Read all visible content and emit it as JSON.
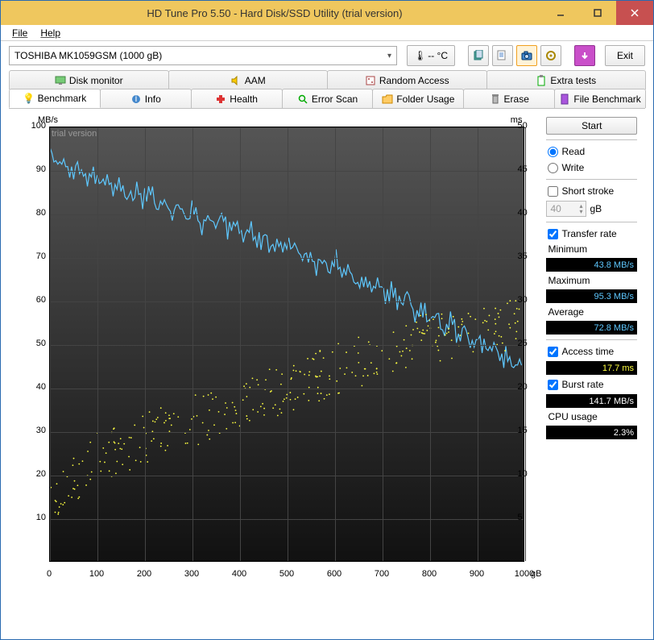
{
  "window": {
    "title": "HD Tune Pro 5.50 - Hard Disk/SSD Utility (trial version)"
  },
  "menu": {
    "file": "File",
    "help": "Help"
  },
  "toolbar": {
    "drive_selected": "TOSHIBA MK1059GSM (1000 gB)",
    "temp": "-- °C",
    "exit_label": "Exit"
  },
  "tabs_top": {
    "disk_monitor": "Disk monitor",
    "aam": "AAM",
    "random_access": "Random Access",
    "extra_tests": "Extra tests"
  },
  "tabs_bottom": {
    "benchmark": "Benchmark",
    "info": "Info",
    "health": "Health",
    "error_scan": "Error Scan",
    "folder_usage": "Folder Usage",
    "erase": "Erase",
    "file_benchmark": "File Benchmark"
  },
  "side": {
    "start": "Start",
    "read": "Read",
    "write": "Write",
    "short_stroke": "Short stroke",
    "short_stroke_val": "40",
    "short_stroke_unit": "gB",
    "transfer_rate": "Transfer rate",
    "minimum": "Minimum",
    "minimum_val": "43.8 MB/s",
    "maximum": "Maximum",
    "maximum_val": "95.3 MB/s",
    "average": "Average",
    "average_val": "72.8 MB/s",
    "access_time": "Access time",
    "access_time_val": "17.7 ms",
    "burst_rate": "Burst rate",
    "burst_rate_val": "141.7 MB/s",
    "cpu_usage": "CPU usage",
    "cpu_usage_val": "2.3%"
  },
  "chart": {
    "y_left_label": "MB/s",
    "y_right_label": "ms",
    "x_unit": "gB",
    "watermark": "trial version"
  },
  "chart_data": {
    "type": "line_and_scatter",
    "x_range": [
      0,
      1000
    ],
    "x_ticks": [
      0,
      100,
      200,
      300,
      400,
      500,
      600,
      700,
      800,
      900,
      1000
    ],
    "y_left_range": [
      0,
      100
    ],
    "y_left_ticks": [
      10,
      20,
      30,
      40,
      50,
      60,
      70,
      80,
      90,
      100
    ],
    "y_right_range": [
      0,
      50
    ],
    "y_right_ticks": [
      5,
      10,
      15,
      20,
      25,
      30,
      35,
      40,
      45,
      50
    ],
    "series": [
      {
        "name": "Transfer rate (MB/s)",
        "axis": "left",
        "type": "line",
        "color": "#5ec8ff",
        "x": [
          0,
          25,
          50,
          75,
          100,
          125,
          150,
          175,
          200,
          225,
          250,
          275,
          300,
          325,
          350,
          375,
          400,
          425,
          450,
          475,
          500,
          525,
          550,
          575,
          600,
          625,
          650,
          675,
          700,
          725,
          750,
          775,
          800,
          825,
          850,
          875,
          900,
          925,
          950,
          975,
          1000
        ],
        "y": [
          95,
          92,
          90,
          89,
          88,
          87,
          86,
          84,
          85,
          83,
          82,
          81,
          80,
          78,
          79,
          77,
          76,
          75,
          74,
          72,
          73,
          71,
          70,
          68,
          69,
          66,
          65,
          64,
          62,
          61,
          60,
          58,
          57,
          55,
          54,
          52,
          51,
          49,
          48,
          46,
          44
        ]
      },
      {
        "name": "Access time (ms)",
        "axis": "right",
        "type": "scatter",
        "color": "#ffff40",
        "note": "approx 300 random samples, roughly increasing trend",
        "x_sample": [
          5,
          20,
          40,
          60,
          80,
          100,
          150,
          200,
          250,
          300,
          350,
          400,
          450,
          500,
          550,
          600,
          650,
          700,
          750,
          800,
          850,
          900,
          950,
          1000
        ],
        "y_sample": [
          6,
          8,
          9,
          10,
          11,
          12,
          13,
          14,
          15,
          16,
          17,
          18,
          19,
          20,
          21,
          22,
          23,
          24,
          25,
          26,
          26,
          27,
          27,
          28
        ]
      }
    ]
  }
}
